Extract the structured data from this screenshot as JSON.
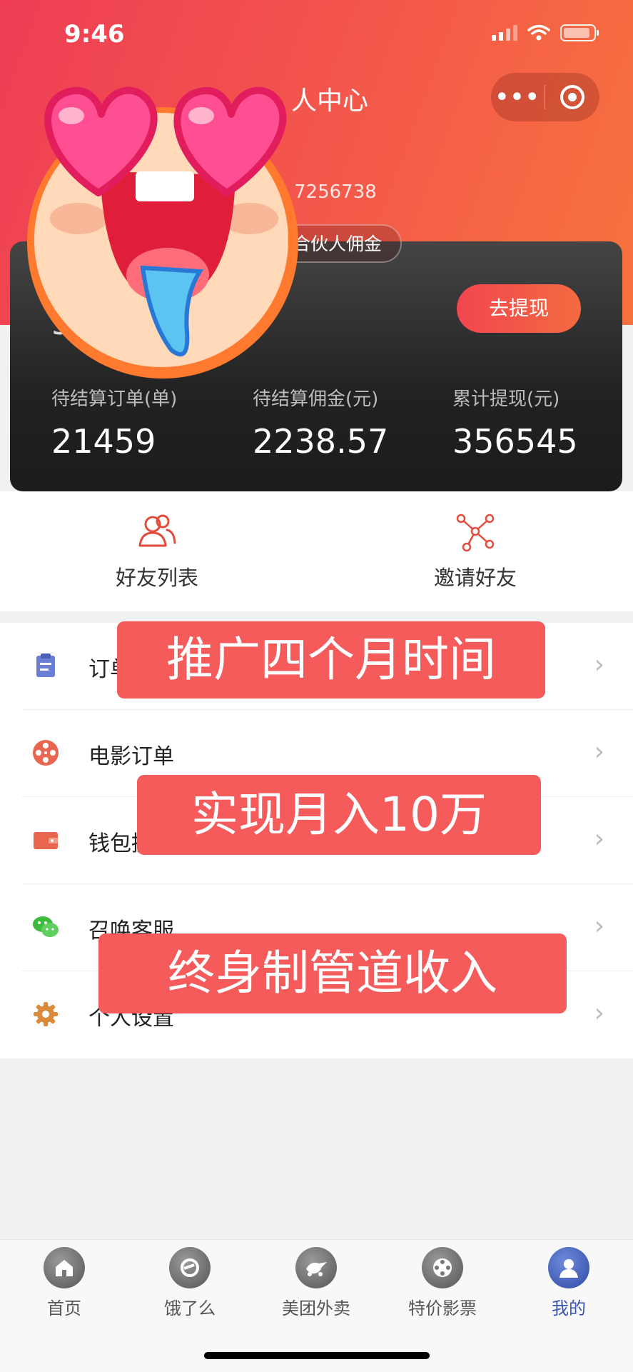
{
  "status_bar": {
    "time": "9:46"
  },
  "header": {
    "title": "人中心",
    "phone_partial": "7256738",
    "partner_badge": "合伙人佣金",
    "capsule_more": "•••"
  },
  "card": {
    "balance_partial": "54",
    "withdraw_label": "去提现",
    "stats": [
      {
        "label": "待结算订单(单)",
        "value": "21459"
      },
      {
        "label": "待结算佣金(元)",
        "value": "2238.57"
      },
      {
        "label": "累计提现(元)",
        "value": "356545"
      }
    ]
  },
  "quick_actions": [
    {
      "label": "好友列表",
      "icon": "friends-icon"
    },
    {
      "label": "邀请好友",
      "icon": "share-network-icon"
    }
  ],
  "menu": [
    {
      "label": "订单",
      "icon": "clipboard-icon",
      "color": "#6b7fd6"
    },
    {
      "label": "电影订单",
      "icon": "film-reel-icon",
      "color": "#e8664f"
    },
    {
      "label": "钱包提现",
      "icon": "wallet-icon",
      "color": "#e8664f"
    },
    {
      "label": "召唤客服",
      "icon": "wechat-icon",
      "color": "#3dbb3d"
    },
    {
      "label": "个人设置",
      "icon": "gear-icon",
      "color": "#d98a3a"
    }
  ],
  "overlays": [
    "推广四个月时间",
    "实现月入10万",
    "终身制管道收入"
  ],
  "tabbar": [
    {
      "label": "首页",
      "icon": "home-icon"
    },
    {
      "label": "饿了么",
      "icon": "eleme-icon"
    },
    {
      "label": "美团外卖",
      "icon": "meituan-icon"
    },
    {
      "label": "特价影票",
      "icon": "film-icon"
    },
    {
      "label": "我的",
      "icon": "user-icon",
      "active": true
    }
  ],
  "colors": {
    "brand_red": "#ee3d55",
    "brand_orange": "#f7733d",
    "overlay": "#f45b5a",
    "tab_active": "#3a55b0"
  }
}
